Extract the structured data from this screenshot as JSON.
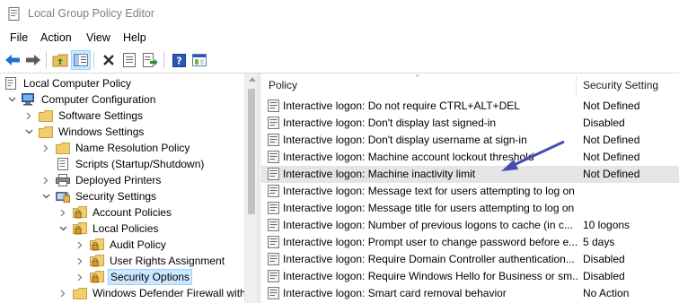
{
  "window": {
    "title": "Local Group Policy Editor"
  },
  "menu": [
    "File",
    "Action",
    "View",
    "Help"
  ],
  "toolbar": [
    "back-arrow-icon",
    "forward-arrow-icon",
    "up-folder-icon",
    "show-hide-tree-icon",
    "delete-icon",
    "properties-icon",
    "export-list-icon",
    "help-icon",
    "console-icon"
  ],
  "tree": [
    {
      "label": "Local Computer Policy",
      "depth": 0,
      "expander": "none",
      "icon": "policy-doc-icon"
    },
    {
      "label": "Computer Configuration",
      "depth": 1,
      "expander": "open",
      "icon": "computer-icon"
    },
    {
      "label": "Software Settings",
      "depth": 2,
      "expander": "closed",
      "icon": "folder-icon"
    },
    {
      "label": "Windows Settings",
      "depth": 2,
      "expander": "open",
      "icon": "folder-icon"
    },
    {
      "label": "Name Resolution Policy",
      "depth": 3,
      "expander": "closed",
      "icon": "folder-icon"
    },
    {
      "label": "Scripts (Startup/Shutdown)",
      "depth": 3,
      "expander": "none",
      "icon": "script-icon"
    },
    {
      "label": "Deployed Printers",
      "depth": 3,
      "expander": "closed",
      "icon": "printer-icon"
    },
    {
      "label": "Security Settings",
      "depth": 3,
      "expander": "open",
      "icon": "security-icon"
    },
    {
      "label": "Account Policies",
      "depth": 4,
      "expander": "closed",
      "icon": "locked-folder-icon"
    },
    {
      "label": "Local Policies",
      "depth": 4,
      "expander": "open",
      "icon": "locked-folder-icon"
    },
    {
      "label": "Audit Policy",
      "depth": 5,
      "expander": "closed",
      "icon": "locked-folder-icon"
    },
    {
      "label": "User Rights Assignment",
      "depth": 5,
      "expander": "closed",
      "icon": "locked-folder-icon"
    },
    {
      "label": "Security Options",
      "depth": 5,
      "expander": "closed",
      "icon": "locked-folder-icon",
      "selected": true
    },
    {
      "label": "Windows Defender Firewall with",
      "depth": 4,
      "expander": "closed",
      "icon": "folder-icon"
    }
  ],
  "list": {
    "columns": {
      "policy": "Policy",
      "setting": "Security Setting"
    },
    "rows": [
      {
        "policy": "Interactive logon: Do not require CTRL+ALT+DEL",
        "setting": "Not Defined"
      },
      {
        "policy": "Interactive logon: Don't display last signed-in",
        "setting": "Disabled"
      },
      {
        "policy": "Interactive logon: Don't display username at sign-in",
        "setting": "Not Defined"
      },
      {
        "policy": "Interactive logon: Machine account lockout threshold",
        "setting": "Not Defined"
      },
      {
        "policy": "Interactive logon: Machine inactivity limit",
        "setting": "Not Defined",
        "highlight": true
      },
      {
        "policy": "Interactive logon: Message text for users attempting to log on",
        "setting": ""
      },
      {
        "policy": "Interactive logon: Message title for users attempting to log on",
        "setting": ""
      },
      {
        "policy": "Interactive logon: Number of previous logons to cache (in c...",
        "setting": "10 logons"
      },
      {
        "policy": "Interactive logon: Prompt user to change password before e...",
        "setting": "5 days"
      },
      {
        "policy": "Interactive logon: Require Domain Controller authentication...",
        "setting": "Disabled"
      },
      {
        "policy": "Interactive logon: Require Windows Hello for Business or sm...",
        "setting": "Disabled"
      },
      {
        "policy": "Interactive logon: Smart card removal behavior",
        "setting": "No Action"
      }
    ]
  },
  "colors": {
    "selection": "#cce8ff",
    "highlight_row": "#e5e5e5",
    "annotation_arrow": "#4b4bb4"
  }
}
